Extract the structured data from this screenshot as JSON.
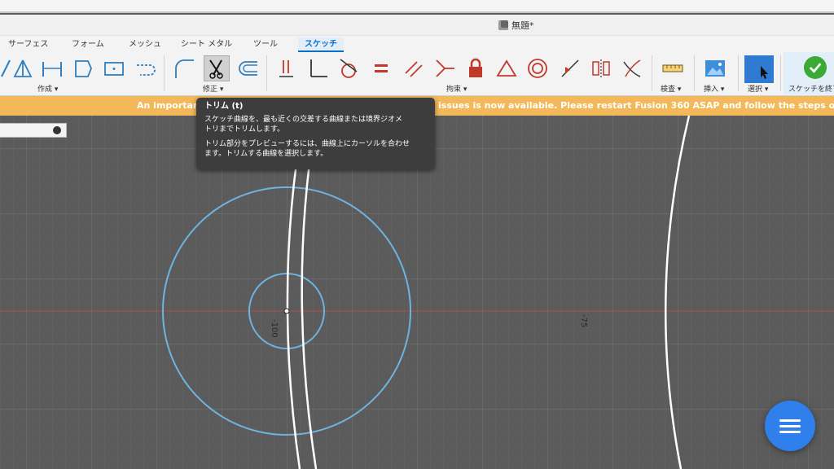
{
  "document": {
    "title": "無題*"
  },
  "tabs": [
    "サーフェス",
    "フォーム",
    "メッシュ",
    "シート メタル",
    "ツール",
    "スケッチ"
  ],
  "active_tab": "スケッチ",
  "groups": {
    "create": "作成 ▾",
    "modify": "修正 ▾",
    "constraints": "拘束 ▾",
    "inspect": "検査 ▾",
    "insert": "挿入 ▾",
    "select": "選択 ▾",
    "finish": "スケッチを終了"
  },
  "banner": {
    "left": "An important",
    "right": "issues is now available. Please restart Fusion 360 ASAP and follow the steps outlined"
  },
  "tooltip": {
    "title": "トリム (t)",
    "line1": "スケッチ曲線を、最も近くの交差する曲線または境界ジオメ\nトリまでトリムします。",
    "line2": "トリム部分をプレビューするには、曲線上にカーソルを合わせ\nます。トリムする曲線を選択します。"
  },
  "dimensions": {
    "d1": "-100",
    "d2": "-75"
  },
  "colors": {
    "accent": "#0b6fc6",
    "banner": "#f2b85a",
    "sketch_curve": "#6fb3e0",
    "fab": "#2f80ed"
  },
  "icons": [
    "line-icon",
    "triangle-icon",
    "dimension-icon",
    "polygon-icon",
    "rectangle-icon",
    "slot-icon",
    "fillet-icon",
    "trim-icon",
    "offset-icon",
    "coincident-icon",
    "perpendicular-icon",
    "tangent-icon",
    "equal-icon",
    "parallel-icon",
    "collinear-icon",
    "lock-icon",
    "triangle-constraint-icon",
    "concentric-icon",
    "midpoint-icon",
    "symmetry-icon",
    "curvature-icon",
    "measure-icon",
    "insert-image-icon",
    "select-icon",
    "finish-check-icon",
    "menu-icon"
  ]
}
